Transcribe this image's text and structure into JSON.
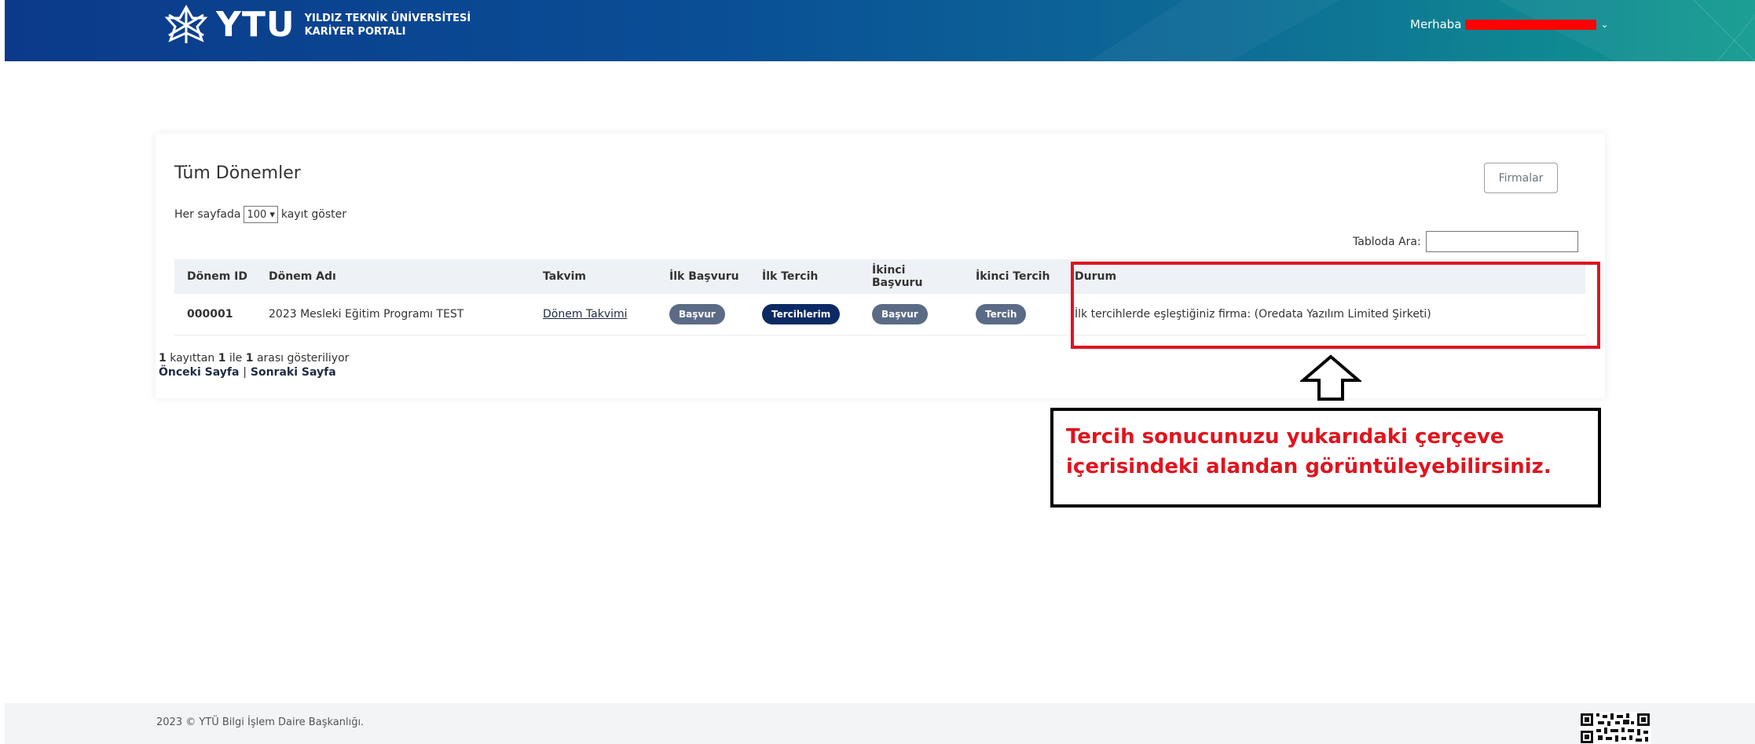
{
  "header": {
    "brand_short": "YTU",
    "brand_line1": "YILDIZ TEKNİK ÜNİVERSİTESİ",
    "brand_line2": "KARİYER PORTALI",
    "greeting": "Merhaba",
    "user_menu_icon": "chevron-down-icon",
    "logo_icon": "star-logo-icon"
  },
  "card": {
    "title": "Tüm Dönemler",
    "firmalar_label": "Firmalar",
    "perpage_prefix": "Her sayfada",
    "perpage_value": "100",
    "perpage_suffix": "kayıt göster",
    "search_label": "Tabloda Ara:",
    "search_value": ""
  },
  "table": {
    "headers": [
      "Dönem ID",
      "Dönem Adı",
      "Takvim",
      "İlk Başvuru",
      "İlk Tercih",
      "İkinci Başvuru",
      "İkinci Tercih",
      "Durum"
    ],
    "rows": [
      {
        "id": "000001",
        "name": "2023 Mesleki Eğitim Programı TEST",
        "calendar": "Dönem Takvimi",
        "first_apply": "Başvur",
        "first_pref": "Tercihlerim",
        "second_apply": "Başvur",
        "second_pref": "Tercih",
        "status": "İlk tercihlerde eşleştiğiniz firma: (Oredata Yazılım Limited Şirketi)"
      }
    ]
  },
  "pagination": {
    "total": "1",
    "t1": "kayıttan",
    "from": "1",
    "t2": "ile",
    "to": "1",
    "t3": "arası gösteriliyor",
    "prev": "Önceki Sayfa",
    "sep": "|",
    "next": "Sonraki Sayfa"
  },
  "annotation": {
    "line1": "Tercih sonucunuzu yukarıdaki çerçeve",
    "line2": "içerisindeki alandan görüntüleyebilirsiniz.",
    "arrow_icon": "up-arrow-icon",
    "highlight_color": "#e0141e"
  },
  "footer": {
    "copyright": "2023 © YTÜ Bilgi İşlem Daire Başkanlığı.",
    "qr_icon": "qr-code-icon"
  }
}
